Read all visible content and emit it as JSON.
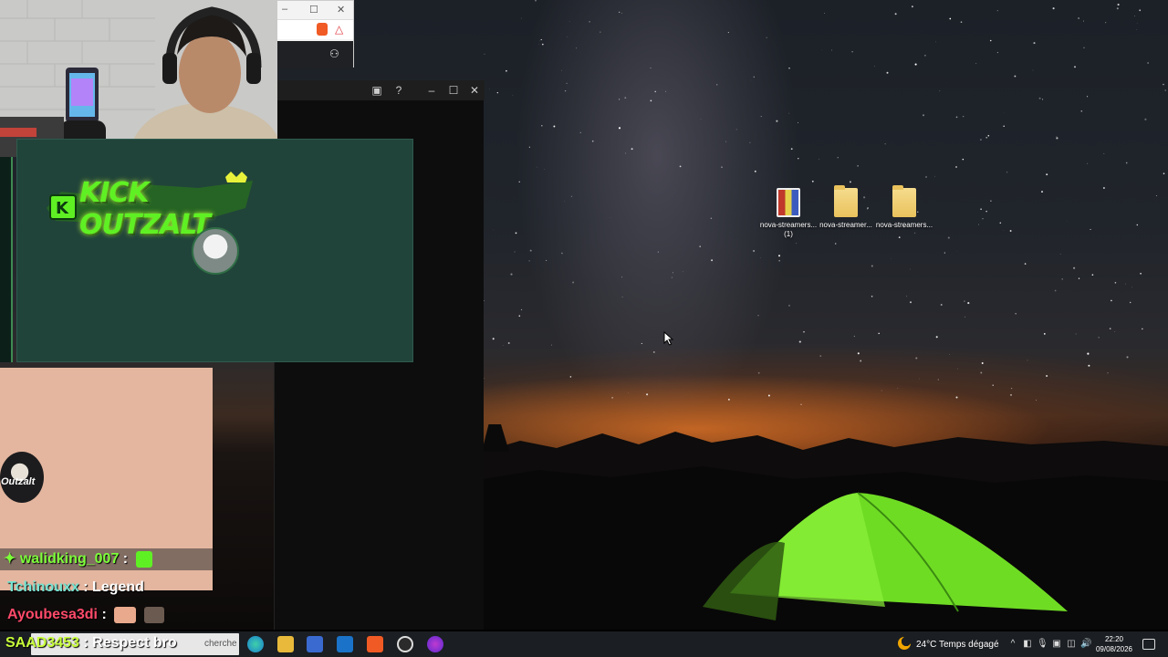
{
  "desktop": {
    "icons": [
      {
        "label_line1": "nova-streamers...",
        "label_line2": "(1)",
        "type": "archive-icon"
      },
      {
        "label_line1": "nova-streamer...",
        "label_line2": "",
        "type": "folder-icon"
      },
      {
        "label_line1": "nova-streamers...",
        "label_line2": "",
        "type": "folder-icon"
      }
    ]
  },
  "overlay": {
    "banner_logo": "KICK OUTZALT",
    "panel_avatar_text": "Outzalt"
  },
  "chat": {
    "lines": [
      {
        "user": "walidking_007",
        "sep": " :",
        "message": ""
      },
      {
        "user": "Tchinouxx",
        "sep": " : ",
        "message": "Legend"
      },
      {
        "user": "Ayoubesa3di",
        "sep": " :",
        "message": ""
      },
      {
        "user": "SAAD3453",
        "sep": " : ",
        "message": "Respect bro"
      }
    ]
  },
  "taskbar": {
    "search_placeholder": "cherche",
    "weather_temp": "24°C",
    "weather_desc": "Temps dégagé",
    "time": "22:20",
    "date": "09/08/2026"
  },
  "colors": {
    "banner": "#21443a",
    "peach": "#e4b69f",
    "kick_green": "#5ff024",
    "taskbar": "#1b1e22"
  }
}
